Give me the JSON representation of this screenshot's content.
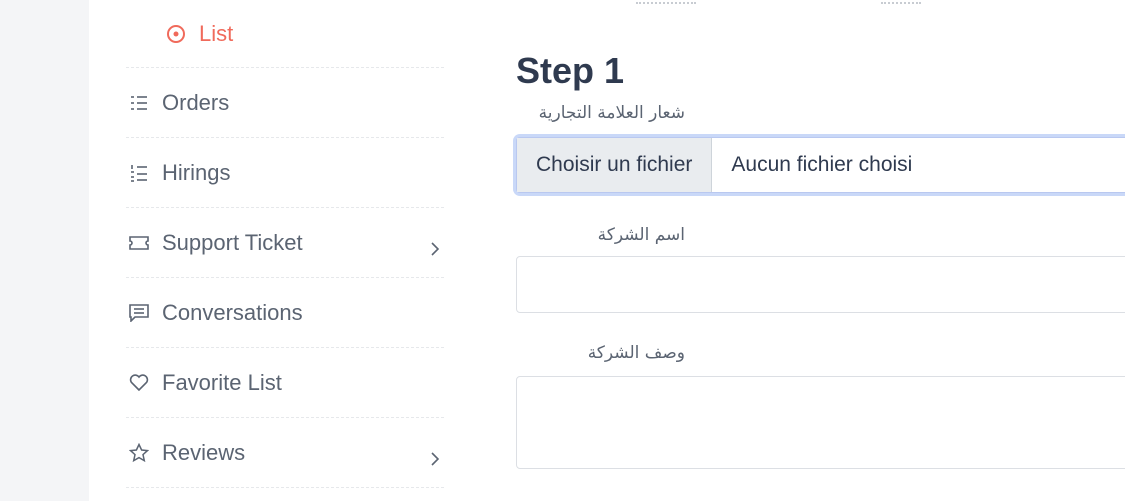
{
  "sidebar": {
    "items": [
      {
        "label": "List",
        "icon": "radio-circle-icon",
        "sub": true
      },
      {
        "label": "Orders",
        "icon": "list-icon"
      },
      {
        "label": "Hirings",
        "icon": "numbered-list-icon"
      },
      {
        "label": "Support Ticket",
        "icon": "ticket-icon",
        "chevron": true
      },
      {
        "label": "Conversations",
        "icon": "message-icon"
      },
      {
        "label": "Favorite List",
        "icon": "heart-icon"
      },
      {
        "label": "Reviews",
        "icon": "star-icon",
        "chevron": true
      }
    ]
  },
  "form": {
    "step_title": "Step 1",
    "brand_logo_label": "شعار العلامة التجارية",
    "file_button": "Choisir un fichier",
    "file_status": "Aucun fichier choisi",
    "company_name_label": "اسم الشركة",
    "company_name_value": "",
    "company_desc_label": "وصف الشركة",
    "company_desc_value": ""
  },
  "colors": {
    "accent": "#f06a5b",
    "text": "#5b6472",
    "heading": "#2f3a4f",
    "focus_ring": "#c9d8f8"
  }
}
